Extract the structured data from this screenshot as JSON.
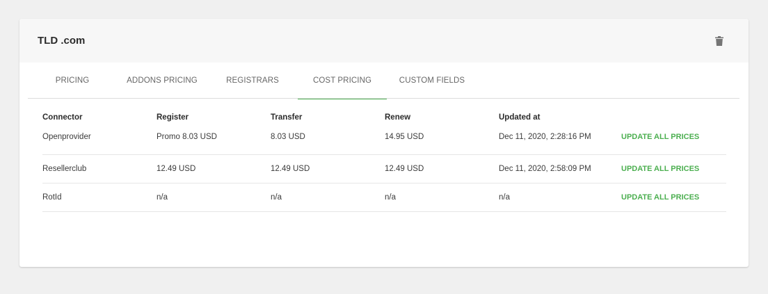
{
  "header": {
    "title": "TLD .com"
  },
  "tabs": [
    {
      "label": "PRICING"
    },
    {
      "label": "ADDONS PRICING"
    },
    {
      "label": "REGISTRARS"
    },
    {
      "label": "COST PRICING"
    },
    {
      "label": "CUSTOM FIELDS"
    }
  ],
  "active_tab": "COST PRICING",
  "table": {
    "columns": [
      "Connector",
      "Register",
      "Transfer",
      "Renew",
      "Updated at"
    ],
    "rows": [
      {
        "connector": "Openprovider",
        "register": "Promo 8.03 USD",
        "transfer": "8.03 USD",
        "renew": "14.95 USD",
        "updated": "Dec 11, 2020, 2:28:16 PM",
        "action": "UPDATE ALL PRICES"
      },
      {
        "connector": "Resellerclub",
        "register": "12.49 USD",
        "transfer": "12.49 USD",
        "renew": "12.49 USD",
        "updated": "Dec 11, 2020, 2:58:09 PM",
        "action": "UPDATE ALL PRICES"
      },
      {
        "connector": "RotId",
        "register": "n/a",
        "transfer": "n/a",
        "renew": "n/a",
        "updated": "n/a",
        "action": "UPDATE ALL PRICES"
      }
    ]
  },
  "colors": {
    "accent": "#4caf50",
    "background": "#f0f0f0",
    "header_bg": "#f7f7f7"
  },
  "icons": {
    "delete": "trash-icon"
  }
}
